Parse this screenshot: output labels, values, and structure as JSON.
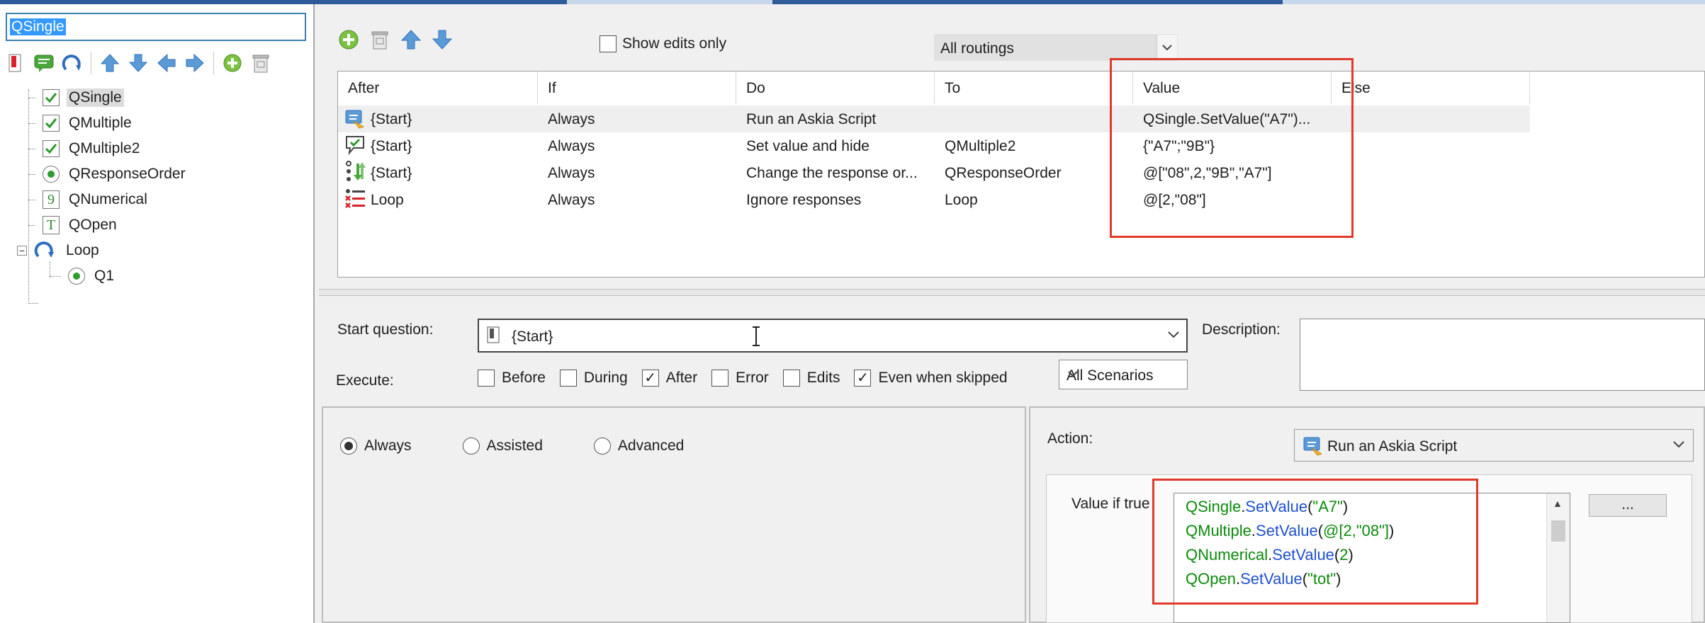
{
  "question_name": "QSingle",
  "tree": {
    "items": [
      {
        "label": "QSingle",
        "icon": "single-check-icon"
      },
      {
        "label": "QMultiple",
        "icon": "multiple-check-icon"
      },
      {
        "label": "QMultiple2",
        "icon": "multiple-check-icon"
      },
      {
        "label": "QResponseOrder",
        "icon": "radio-icon"
      },
      {
        "label": "QNumerical",
        "icon": "numeric-icon",
        "glyph": "9"
      },
      {
        "label": "QOpen",
        "icon": "text-icon",
        "glyph": "T"
      },
      {
        "label": "Loop",
        "icon": "loop-icon",
        "expander": "−"
      },
      {
        "label": "Q1",
        "icon": "radio-icon"
      }
    ]
  },
  "routing_toolbar": {
    "show_edits_label": "Show edits only",
    "routings_filter": "All routings"
  },
  "routing_grid": {
    "columns": [
      "After",
      "If",
      "Do",
      "To",
      "Value",
      "Else"
    ],
    "rows": [
      {
        "after": "{Start}",
        "if": "Always",
        "do": "Run an Askia Script",
        "to": "",
        "value": "QSingle.SetValue(\"A7\")...",
        "else": "",
        "icon": "script-icon"
      },
      {
        "after": "{Start}",
        "if": "Always",
        "do": "Set value and hide",
        "to": "QMultiple2",
        "value": "{\"A7\";\"9B\"}",
        "else": "",
        "icon": "set-value-icon"
      },
      {
        "after": "{Start}",
        "if": "Always",
        "do": "Change the response or...",
        "to": "QResponseOrder",
        "value": "@[\"08\",2,\"9B\",\"A7\"]",
        "else": "",
        "icon": "reorder-icon"
      },
      {
        "after": "Loop",
        "if": "Always",
        "do": "Ignore responses",
        "to": "Loop",
        "value": "@[2,\"08\"]",
        "else": "",
        "icon": "ignore-icon"
      }
    ]
  },
  "properties": {
    "start_question_label": "Start question:",
    "start_question_value": "{Start}",
    "description_label": "Description:",
    "execute_label": "Execute:",
    "execute_options": [
      {
        "label": "Before",
        "checked": false
      },
      {
        "label": "During",
        "checked": false
      },
      {
        "label": "After",
        "checked": true
      },
      {
        "label": "Error",
        "checked": false
      },
      {
        "label": "Edits",
        "checked": false
      },
      {
        "label": "Even when skipped",
        "checked": true
      }
    ],
    "scenarios": "All Scenarios"
  },
  "condition": {
    "options": [
      {
        "label": "Always",
        "selected": true
      },
      {
        "label": "Assisted",
        "selected": false
      },
      {
        "label": "Advanced",
        "selected": false
      }
    ]
  },
  "action": {
    "label": "Action:",
    "value": "Run an Askia Script",
    "value_if_true_label": "Value if true",
    "ellipsis_button": "...",
    "script_lines": [
      {
        "obj": "QSingle",
        "dot": ".",
        "method": "SetValue",
        "open": "(",
        "arg": "\"A7\"",
        "close": ")"
      },
      {
        "obj": "QMultiple",
        "dot": ".",
        "method": "SetValue",
        "open": "(",
        "arg": "@[2,\"08\"]",
        "close": ")"
      },
      {
        "obj": "QNumerical",
        "dot": ".",
        "method": "SetValue",
        "open": "(",
        "arg": "2",
        "close": ")"
      },
      {
        "obj": "QOpen",
        "dot": ".",
        "method": "SetValue",
        "open": "(",
        "arg": "\"tot\"",
        "close": ")"
      }
    ]
  },
  "colors": {
    "highlight": "#e03a2a",
    "selection": "#3399ff",
    "green": "#2e9b2e"
  }
}
